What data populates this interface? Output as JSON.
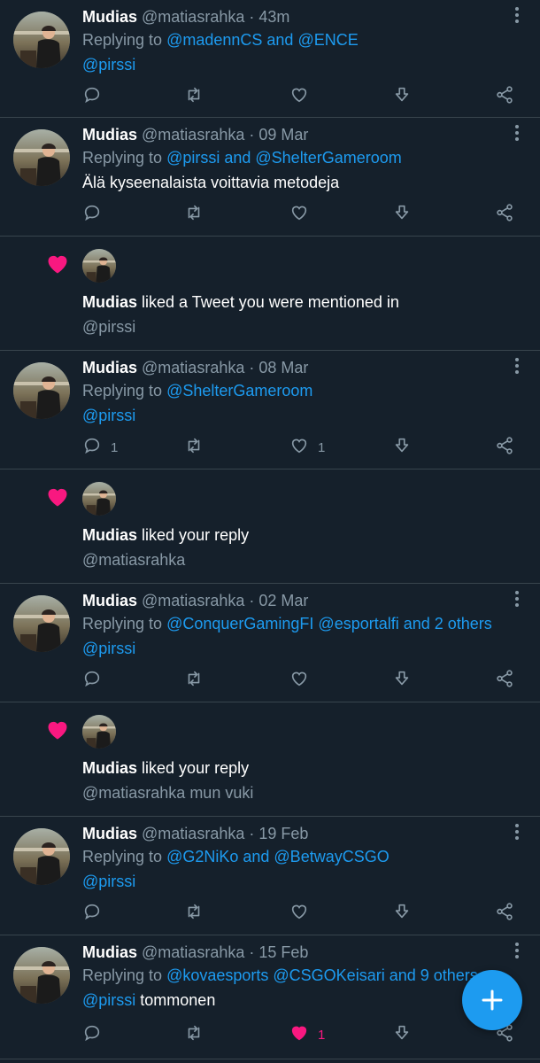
{
  "colors": {
    "background": "#15202b",
    "accent": "#1d9bf0",
    "like": "#f91880",
    "muted": "#8899a6",
    "divider": "#38444d"
  },
  "items": [
    {
      "type": "tweet",
      "name": "Mudias",
      "handle": "@matiasrahka",
      "time": "43m",
      "replying_prefix": "Replying to",
      "replying_to": "@madennCS and @ENCE",
      "line2_link": "@pirssi",
      "line2_text": "",
      "reply_count": "",
      "like_count": "",
      "liked": false
    },
    {
      "type": "tweet",
      "name": "Mudias",
      "handle": "@matiasrahka",
      "time": "09 Mar",
      "replying_prefix": "Replying to",
      "replying_to": "@pirssi and @ShelterGameroom",
      "line2_link": "",
      "line2_text": "Älä kyseenalaista voittavia metodeja",
      "reply_count": "",
      "like_count": "",
      "liked": false
    },
    {
      "type": "like",
      "name": "Mudias",
      "action": "liked a Tweet you were mentioned in",
      "sub": "@pirssi"
    },
    {
      "type": "tweet",
      "name": "Mudias",
      "handle": "@matiasrahka",
      "time": "08 Mar",
      "replying_prefix": "Replying to",
      "replying_to": "@ShelterGameroom",
      "line2_link": "@pirssi",
      "line2_text": "",
      "reply_count": "1",
      "like_count": "1",
      "liked": false
    },
    {
      "type": "like",
      "name": "Mudias",
      "action": "liked your reply",
      "sub": "@matiasrahka"
    },
    {
      "type": "tweet",
      "name": "Mudias",
      "handle": "@matiasrahka",
      "time": "02 Mar",
      "replying_prefix": "Replying to",
      "replying_to": "@ConquerGamingFI @esportalfi and 2 others",
      "line2_link": "@pirssi",
      "line2_text": "",
      "reply_count": "",
      "like_count": "",
      "liked": false
    },
    {
      "type": "like",
      "name": "Mudias",
      "action": "liked your reply",
      "sub": "@matiasrahka mun vuki"
    },
    {
      "type": "tweet",
      "name": "Mudias",
      "handle": "@matiasrahka",
      "time": "19 Feb",
      "replying_prefix": "Replying to",
      "replying_to": "@G2NiKo and @BetwayCSGO",
      "line2_link": "@pirssi",
      "line2_text": "",
      "reply_count": "",
      "like_count": "",
      "liked": false
    },
    {
      "type": "tweet",
      "name": "Mudias",
      "handle": "@matiasrahka",
      "time": "15 Feb",
      "replying_prefix": "Replying to",
      "replying_to": "@kovaesports @CSGOKeisari and 9 others",
      "line2_link": "@pirssi",
      "line2_text": " tommonen",
      "reply_count": "",
      "like_count": "1",
      "liked": true
    }
  ],
  "fab": {
    "icon": "plus-icon"
  }
}
